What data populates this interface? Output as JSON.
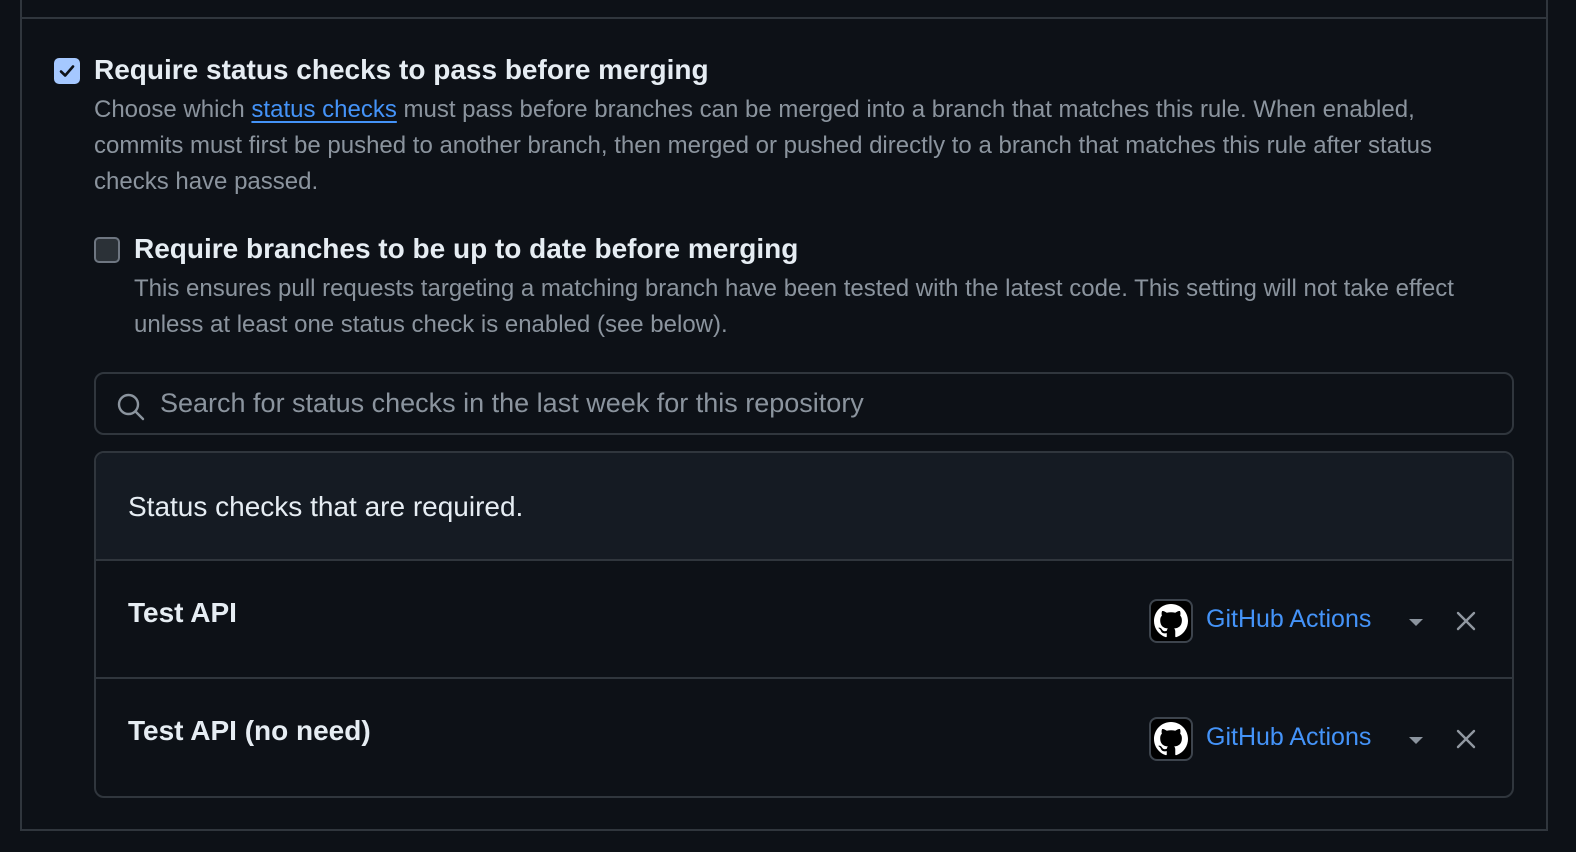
{
  "require_status_checks": {
    "checked": true,
    "title": "Require status checks to pass before merging",
    "desc_before_link": "Choose which ",
    "link_text": "status checks",
    "desc_after_link": " must pass before branches can be merged into a branch that matches this rule. When enabled, commits must first be pushed to another branch, then merged or pushed directly to a branch that matches this rule after status checks have passed."
  },
  "require_up_to_date": {
    "checked": false,
    "title": "Require branches to be up to date before merging",
    "desc": "This ensures pull requests targeting a matching branch have been tested with the latest code. This setting will not take effect unless at least one status check is enabled (see below)."
  },
  "search": {
    "placeholder": "Search for status checks in the last week for this repository",
    "value": ""
  },
  "required_checks": {
    "header": "Status checks that are required.",
    "items": [
      {
        "name": "Test API",
        "app": "GitHub Actions",
        "icon": "github-logo-icon"
      },
      {
        "name": "Test API (no need)",
        "app": "GitHub Actions",
        "icon": "github-logo-icon"
      }
    ]
  },
  "colors": {
    "background": "#0d1117",
    "border": "#30363d",
    "link": "#4493f8",
    "muted_text": "#8b949e",
    "checkbox_checked": "#a5c8ff"
  }
}
